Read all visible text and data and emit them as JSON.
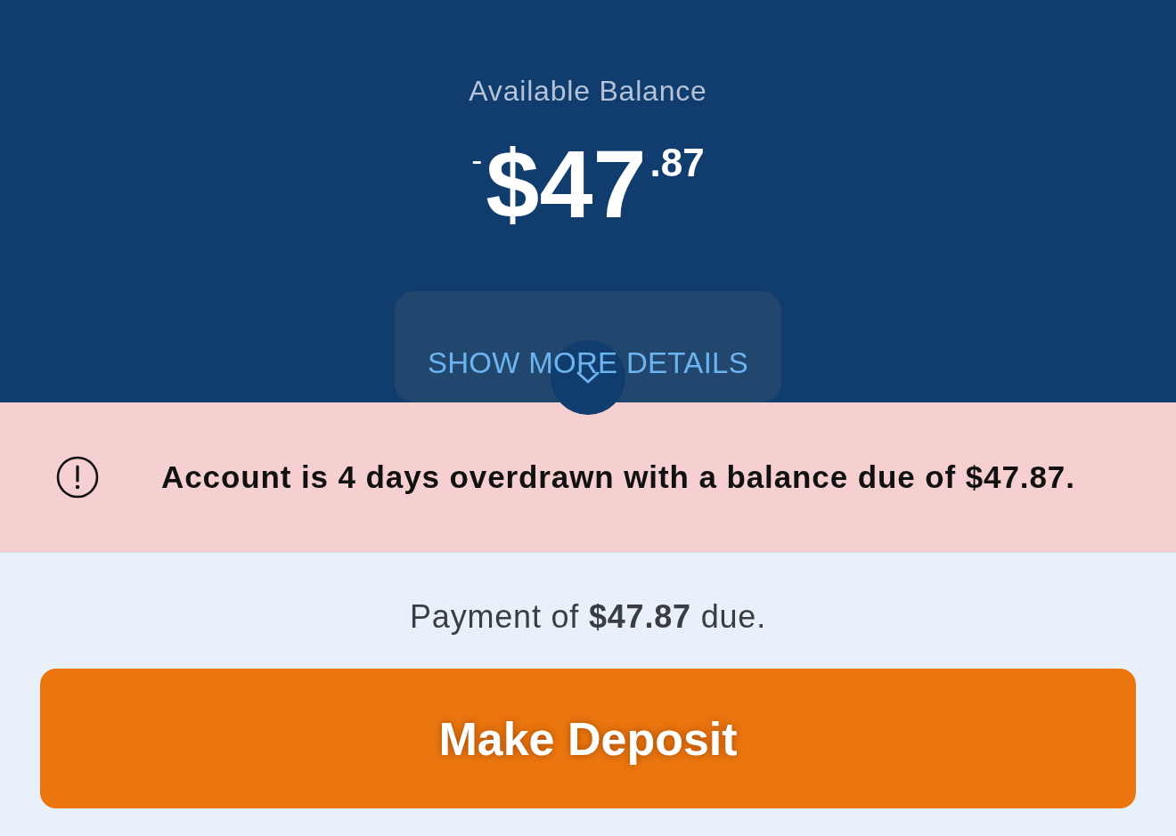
{
  "balance": {
    "label": "Available Balance",
    "sign": "-",
    "amount": "$47",
    "cents": ".87"
  },
  "details_button": {
    "label": "SHOW MORE DETAILS",
    "expanded": false
  },
  "alert": {
    "message": "Account is 4 days overdrawn with a balance due of $47.87."
  },
  "payment": {
    "message": "Payment of **$47.87** due.",
    "button": "Make Deposit"
  }
}
